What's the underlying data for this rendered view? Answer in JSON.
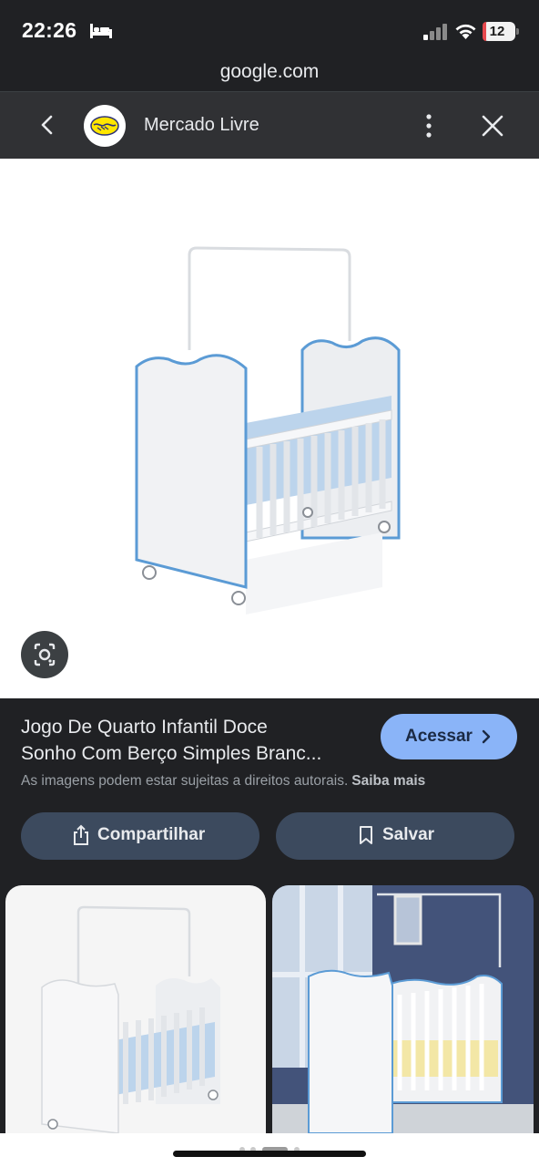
{
  "status_bar": {
    "time": "22:26",
    "battery_level": "12",
    "battery_color": "#e5484d"
  },
  "browser": {
    "url": "google.com"
  },
  "header": {
    "site_name": "Mercado Livre",
    "icons": [
      "back-arrow-icon",
      "mercado-livre-logo",
      "more-vert-icon",
      "close-icon"
    ]
  },
  "result": {
    "title_line1": "Jogo De Quarto Infantil Doce",
    "title_line2": "Sonho Com Berço Simples Branc...",
    "visit_label": "Acessar",
    "copyright_notice": "As imagens podem estar sujeitas a direitos autorais.",
    "learn_more": "Saiba mais",
    "share_label": "Compartilhar",
    "save_label": "Salvar"
  },
  "colors": {
    "accent_button": "#8ab4f8",
    "pill_background": "#3c4a5e",
    "page_background": "#202124",
    "crib_trim": "#5b9bd5"
  }
}
